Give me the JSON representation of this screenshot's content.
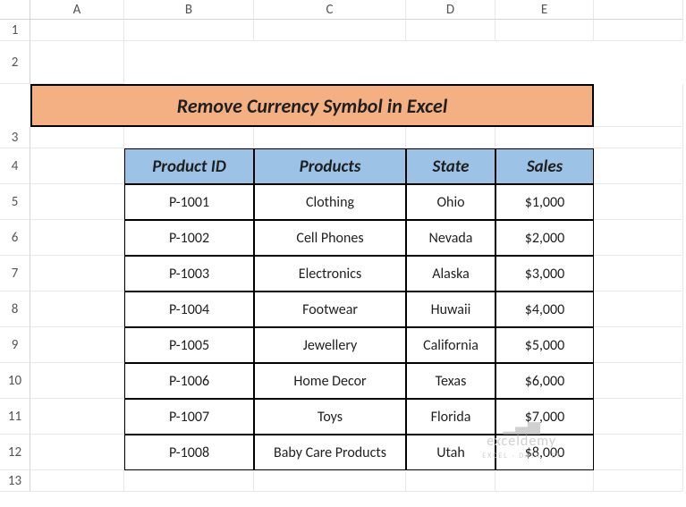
{
  "columns": [
    "A",
    "B",
    "C",
    "D",
    "E"
  ],
  "rows": [
    "1",
    "2",
    "3",
    "4",
    "5",
    "6",
    "7",
    "8",
    "9",
    "10",
    "11",
    "12",
    "13"
  ],
  "title": "Remove Currency Symbol in Excel",
  "headers": {
    "product_id": "Product ID",
    "products": "Products",
    "state": "State",
    "sales": "Sales"
  },
  "data": [
    {
      "id": "P-1001",
      "product": "Clothing",
      "state": "Ohio",
      "sales": "$1,000"
    },
    {
      "id": "P-1002",
      "product": "Cell Phones",
      "state": "Nevada",
      "sales": "$2,000"
    },
    {
      "id": "P-1003",
      "product": "Electronics",
      "state": "Alaska",
      "sales": "$3,000"
    },
    {
      "id": "P-1004",
      "product": "Footwear",
      "state": "Huwaii",
      "sales": "$4,000"
    },
    {
      "id": "P-1005",
      "product": "Jewellery",
      "state": "California",
      "sales": "$5,000"
    },
    {
      "id": "P-1006",
      "product": "Home Decor",
      "state": "Texas",
      "sales": "$6,000"
    },
    {
      "id": "P-1007",
      "product": "Toys",
      "state": "Florida",
      "sales": "$7,000"
    },
    {
      "id": "P-1008",
      "product": "Baby Care Products",
      "state": "Utah",
      "sales": "$8,000"
    }
  ],
  "watermark": {
    "name": "exceldemy",
    "tag": "EXCEL · DATA · BI"
  },
  "chart_data": {
    "type": "table",
    "title": "Remove Currency Symbol in Excel",
    "columns": [
      "Product ID",
      "Products",
      "State",
      "Sales"
    ],
    "rows": [
      [
        "P-1001",
        "Clothing",
        "Ohio",
        "$1,000"
      ],
      [
        "P-1002",
        "Cell Phones",
        "Nevada",
        "$2,000"
      ],
      [
        "P-1003",
        "Electronics",
        "Alaska",
        "$3,000"
      ],
      [
        "P-1004",
        "Footwear",
        "Huwaii",
        "$4,000"
      ],
      [
        "P-1005",
        "Jewellery",
        "California",
        "$5,000"
      ],
      [
        "P-1006",
        "Home Decor",
        "Texas",
        "$6,000"
      ],
      [
        "P-1007",
        "Toys",
        "Florida",
        "$7,000"
      ],
      [
        "P-1008",
        "Baby Care Products",
        "Utah",
        "$8,000"
      ]
    ]
  }
}
